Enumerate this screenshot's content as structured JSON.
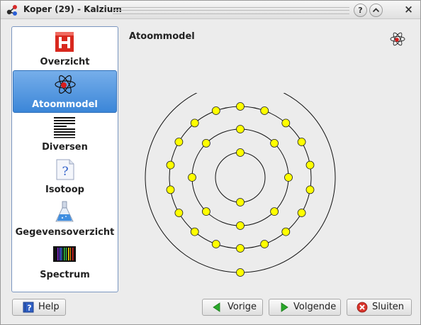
{
  "window": {
    "title": "Koper (29) - Kalzium"
  },
  "titlebar": {
    "help_label": "?",
    "minimize_label": "^",
    "close_label": "×"
  },
  "sidebar": {
    "items": [
      {
        "label": "Overzicht",
        "icon": "element-h-icon",
        "selected": false
      },
      {
        "label": "Atoommodel",
        "icon": "atom-icon",
        "selected": true
      },
      {
        "label": "Diversen",
        "icon": "lines-icon",
        "selected": false
      },
      {
        "label": "Isotoop",
        "icon": "question-document-icon",
        "selected": false
      },
      {
        "label": "Gegevensoverzicht",
        "icon": "flask-icon",
        "selected": false
      },
      {
        "label": "Spectrum",
        "icon": "spectrum-icon",
        "selected": false
      }
    ]
  },
  "main": {
    "title": "Atoommodel",
    "atom_model": {
      "shells": [
        2,
        8,
        18,
        1
      ],
      "electron_color": "#ffff00"
    }
  },
  "buttons": {
    "help": "Help",
    "previous": "Vorige",
    "next": "Volgende",
    "close": "Sluiten"
  },
  "colors": {
    "selection": "#3b86d8",
    "arrow_green": "#2aa82a",
    "close_red": "#d9342b"
  }
}
